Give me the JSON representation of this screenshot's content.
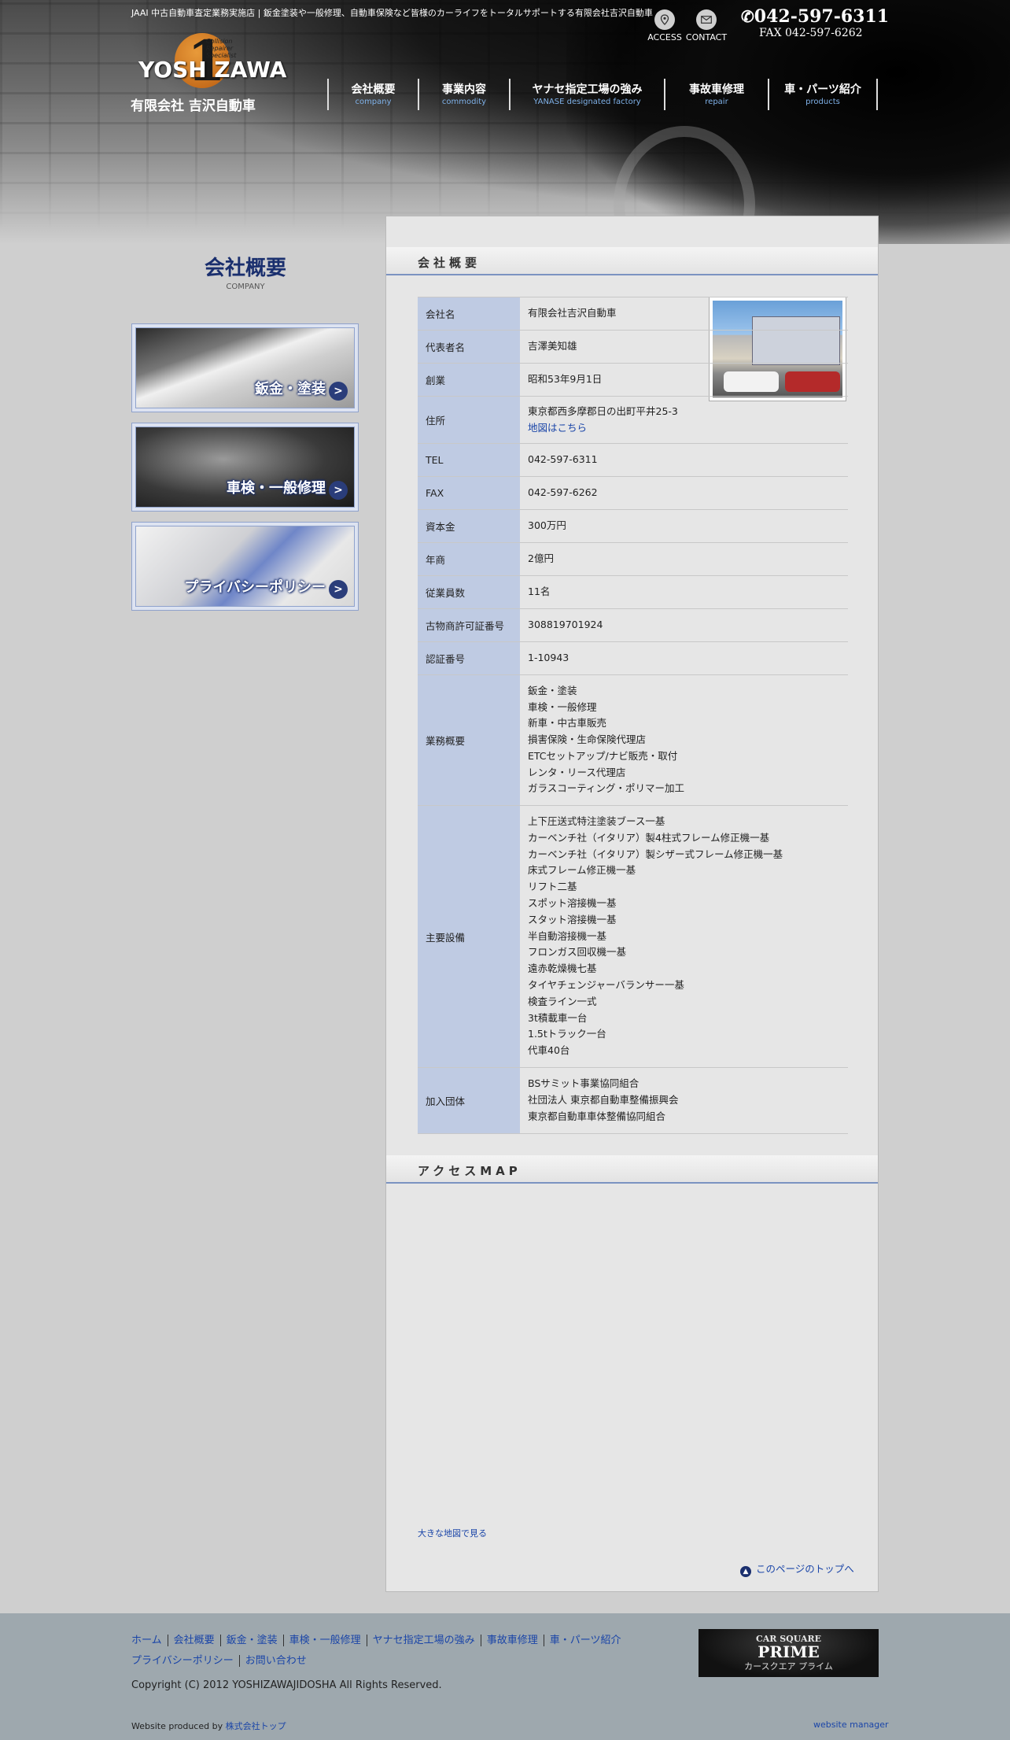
{
  "header": {
    "tagline": "JAAI 中古自動車査定業務実施店 | 鈑金塗装や一般修理、自動車保険など皆様のカーライフをトータルサポートする有限会社吉沢自動車",
    "access_label": "ACCESS",
    "contact_label": "CONTACT",
    "tel": "042-597-6311",
    "fax": "FAX 042-597-6262",
    "logo": {
      "mark": "1",
      "tiny": "Collision Repairer Specialist",
      "word": "YOSH ZAWA",
      "company": "有限会社 吉沢自動車"
    },
    "nav": [
      {
        "jp": "会社概要",
        "en": "company"
      },
      {
        "jp": "事業内容",
        "en": "commodity"
      },
      {
        "jp": "ヤナセ指定工場の強み",
        "en": "YANASE designated factory"
      },
      {
        "jp": "事故車修理",
        "en": "repair"
      },
      {
        "jp": "車・パーツ紹介",
        "en": "products"
      }
    ]
  },
  "sidebar": {
    "title_jp": "会社概要",
    "title_en": "COMPANY",
    "banners": [
      {
        "label": "鈑金・塗装"
      },
      {
        "label": "車検・一般修理"
      },
      {
        "label": "プライバシーポリシー"
      }
    ],
    "chevron": ">"
  },
  "main": {
    "company_heading": "会社概要",
    "access_heading": "アクセスMAP",
    "map_link_label": "地図はこちら",
    "rows": [
      {
        "key": "会社名",
        "value": "有限会社吉沢自動車"
      },
      {
        "key": "代表者名",
        "value": "吉澤美知雄"
      },
      {
        "key": "創業",
        "value": "昭和53年9月1日"
      },
      {
        "key": "住所",
        "value": "東京都西多摩郡日の出町平井25-3"
      },
      {
        "key": "TEL",
        "value": "042-597-6311"
      },
      {
        "key": "FAX",
        "value": "042-597-6262"
      },
      {
        "key": "資本金",
        "value": "300万円"
      },
      {
        "key": "年商",
        "value": "2億円"
      },
      {
        "key": "従業員数",
        "value": "11名"
      },
      {
        "key": "古物商許可証番号",
        "value": "308819701924"
      },
      {
        "key": "認証番号",
        "value": "1-10943"
      },
      {
        "key": "業務概要",
        "lines": [
          "鈑金・塗装",
          "車検・一般修理",
          "新車・中古車販売",
          "損害保険・生命保険代理店",
          "ETCセットアップ/ナビ販売・取付",
          "レンタ・リース代理店",
          "ガラスコーティング・ポリマー加工"
        ]
      },
      {
        "key": "主要設備",
        "lines": [
          "上下圧送式特注塗装ブース一基",
          "カーベンチ社（イタリア）製4柱式フレーム修正機一基",
          "カーベンチ社（イタリア）製シザー式フレーム修正機一基",
          "床式フレーム修正機一基",
          "リフト二基",
          "スポット溶接機一基",
          "スタット溶接機一基",
          "半自動溶接機一基",
          "フロンガス回収機一基",
          "遠赤乾燥機七基",
          "タイヤチェンジャーバランサー一基",
          "検査ライン一式",
          "3t積載車一台",
          "1.5tトラック一台",
          "代車40台"
        ]
      },
      {
        "key": "加入団体",
        "lines": [
          "BSサミット事業協同組合",
          "社団法人 東京都自動車整備振興会",
          "東京都自動車車体整備協同組合"
        ]
      }
    ],
    "big_map_label": "大きな地図で見る",
    "to_top_label": "このページのトップへ"
  },
  "footer": {
    "links_row1": [
      "ホーム",
      "会社概要",
      "鈑金・塗装",
      "車検・一般修理",
      "ヤナセ指定工場の強み",
      "事故車修理",
      "車・パーツ紹介"
    ],
    "links_row2": [
      "プライバシーポリシー",
      "お問い合わせ"
    ],
    "copyright": "Copyright (C) 2012 YOSHIZAWAJIDOSHA All Rights Reserved.",
    "produced_by_prefix": "Website produced by ",
    "produced_by_link": "株式会社トップ",
    "manager": "website manager",
    "prime": {
      "line1": "CAR SQUARE",
      "line2": "PRIME",
      "line3": "カースクエア プライム"
    }
  }
}
